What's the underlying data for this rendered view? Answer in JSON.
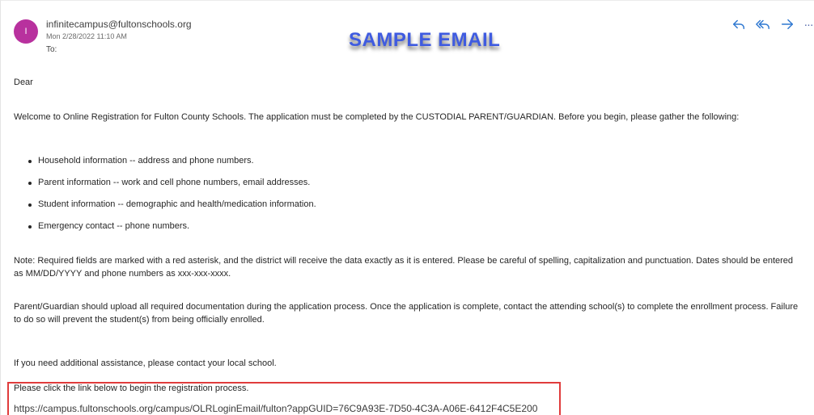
{
  "sender": {
    "avatar_initial": "I",
    "avatar_color": "#b8319e",
    "email": "infinitecampus@fultonschools.org",
    "date": "Mon 2/28/2022 11:10 AM",
    "to_label": "To:"
  },
  "banner": "SAMPLE EMAIL",
  "actions": {
    "reply_icon": "reply-icon",
    "reply_all_icon": "reply-all-icon",
    "forward_icon": "forward-icon",
    "more_label": "···"
  },
  "body": {
    "greeting": "Dear",
    "intro": "Welcome to Online Registration for Fulton County Schools.   The application must be completed by the CUSTODIAL PARENT/GUARDIAN. Before you begin, please gather the following:",
    "bullets": [
      "Household information -- address and phone numbers.",
      "Parent information -- work and cell phone numbers, email addresses.",
      "Student information -- demographic and health/medication information.",
      "Emergency contact -- phone numbers."
    ],
    "note": "Note: Required fields are marked with a red asterisk, and the district will receive the data exactly as it is entered. Please be careful of spelling, capitalization and punctuation. Dates should be entered as MM/DD/YYYY and phone numbers as xxx-xxx-xxxx.",
    "upload": "Parent/Guardian should upload all required documentation during the application process. Once the application is complete, contact the attending school(s) to complete the enrollment process. Failure to do so will prevent the student(s) from being officially enrolled.",
    "assistance": "If you need additional assistance, please contact your local school.",
    "click_instruction": "Please click the link below to begin the registration process.",
    "link": "https://campus.fultonschools.org/campus/OLRLoginEmail/fulton?appGUID=76C9A93E-7D50-4C3A-A06E-6412F4C5E200"
  },
  "colors": {
    "accent": "#2f78d1",
    "banner": "#3f5be0",
    "highlight_border": "#e03c3c"
  }
}
